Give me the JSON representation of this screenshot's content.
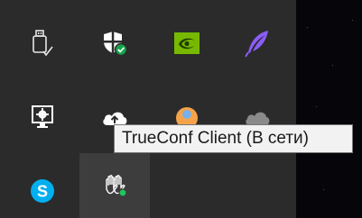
{
  "tray": {
    "icons": [
      {
        "name": "usb-eject-icon",
        "description": "Safely remove hardware"
      },
      {
        "name": "windows-security-icon",
        "description": "Windows Security"
      },
      {
        "name": "nvidia-icon",
        "description": "NVIDIA settings"
      },
      {
        "name": "feather-icon",
        "description": "Feather app"
      },
      {
        "name": "display-settings-icon",
        "description": "Display"
      },
      {
        "name": "cloud-upload-icon",
        "description": "Cloud"
      },
      {
        "name": "orange-app-icon",
        "description": "App"
      },
      {
        "name": "grey-cloud-icon",
        "description": "Cloud"
      },
      {
        "name": "skype-icon",
        "description": "Skype"
      },
      {
        "name": "trueconf-icon",
        "description": "TrueConf Client"
      }
    ],
    "colors": {
      "panel": "#2b2b2b",
      "hover": "#3d3d3d",
      "security_green": "#16a34a",
      "nvidia_green": "#76b900",
      "feather_purple": "#8b5cf6",
      "skype_blue": "#00aff0",
      "status_online": "#22c55e"
    }
  },
  "tooltip": {
    "text": "TrueConf Client (В сети)"
  }
}
